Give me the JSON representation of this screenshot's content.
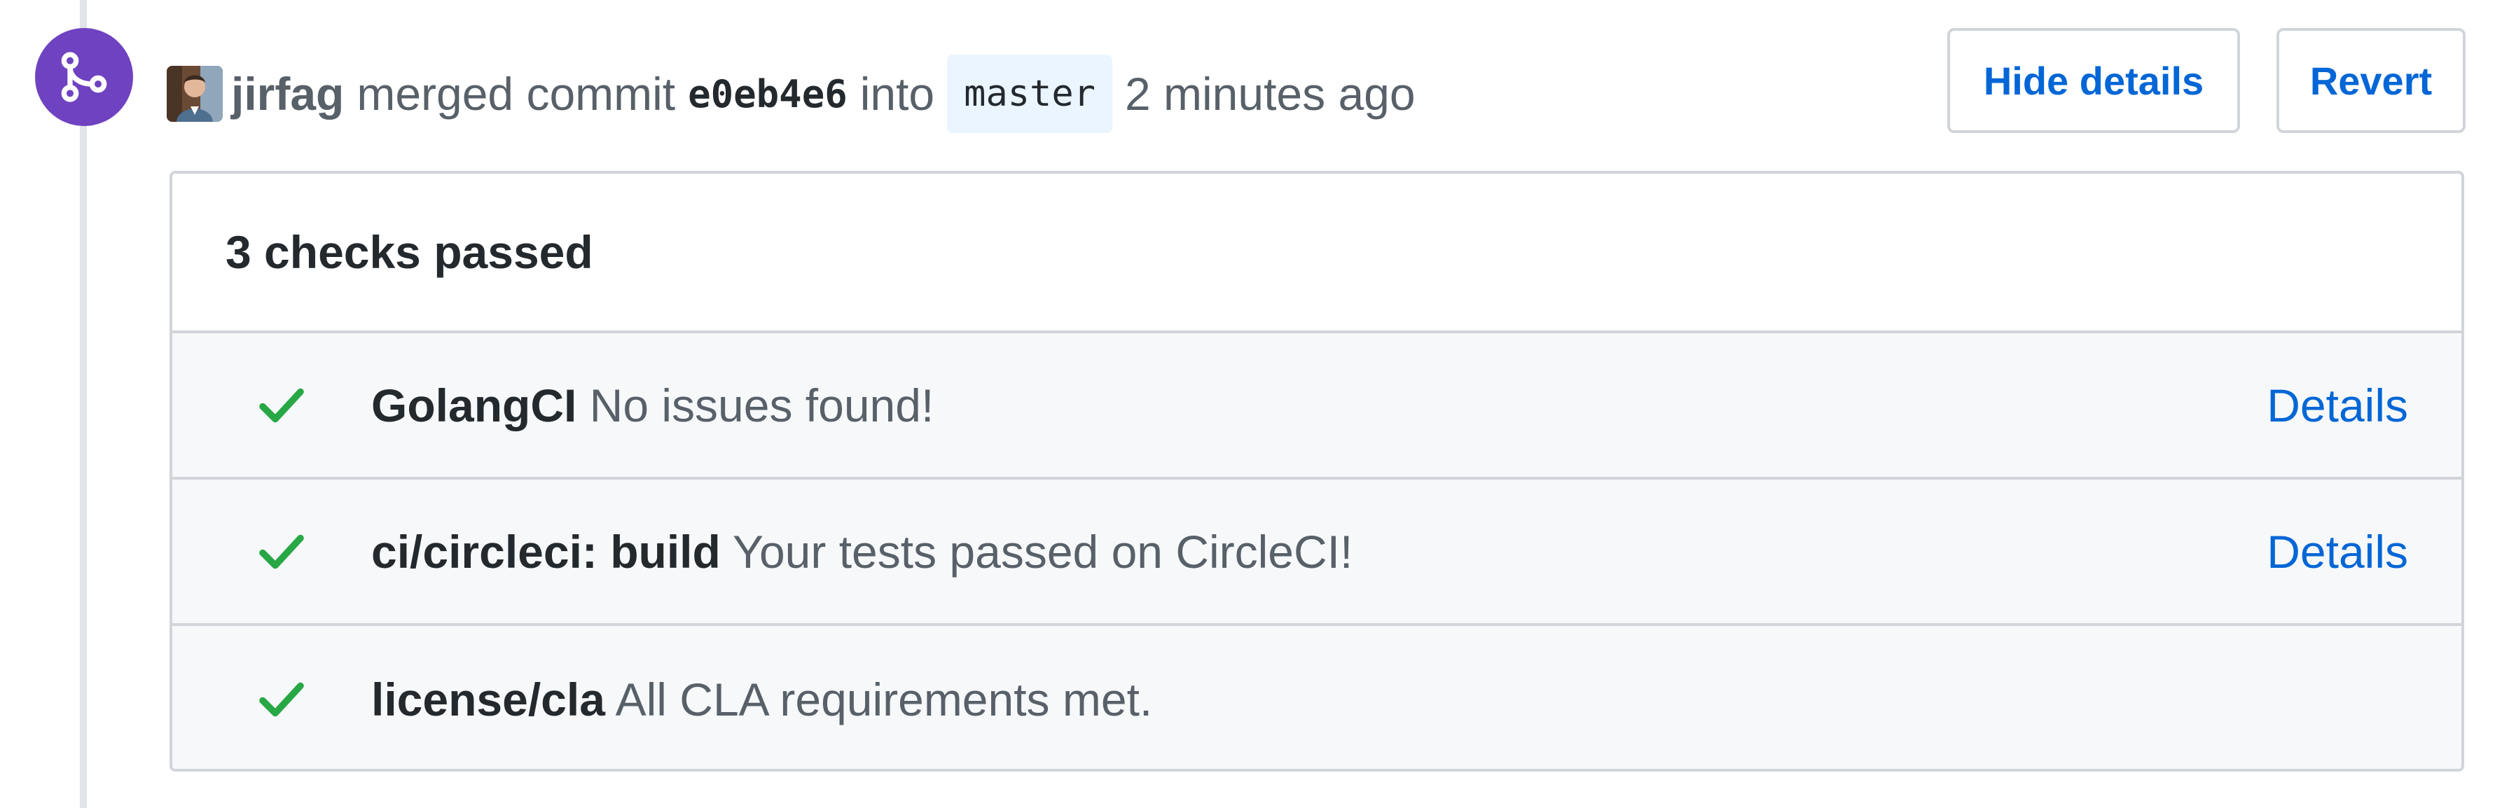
{
  "event": {
    "author": "jirfag",
    "action": "merged commit",
    "commit_sha": "e0eb4e6",
    "into": "into",
    "branch": "master",
    "time_ago": "2 minutes ago"
  },
  "buttons": {
    "hide_details": "Hide details",
    "revert": "Revert"
  },
  "checks": {
    "summary": "3 checks passed",
    "items": [
      {
        "name": "GolangCI",
        "description": "No issues found!",
        "status": "success",
        "details_label": "Details"
      },
      {
        "name": "ci/circleci: build",
        "description": "Your tests passed on CircleCI!",
        "status": "success",
        "details_label": "Details"
      },
      {
        "name": "license/cla",
        "description": "All CLA requirements met.",
        "status": "success",
        "details_label": ""
      }
    ]
  },
  "colors": {
    "merge_badge": "#6f42c1",
    "link": "#0366d6",
    "success": "#28a745",
    "branch_bg": "#eaf5ff"
  },
  "icons": {
    "badge": "git-merge-icon",
    "check": "check-icon"
  }
}
